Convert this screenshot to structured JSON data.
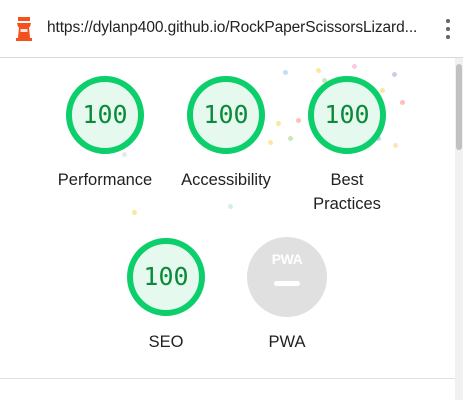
{
  "address_bar": {
    "url": "https://dylanp400.github.io/RockPaperScissorsLizard..."
  },
  "icons": {
    "app": "lighthouse-icon",
    "menu": "more-vert-icon"
  },
  "colors": {
    "pass": "#0cce6b",
    "pass_text": "#0b8a3a",
    "pass_fill": "#e6f9ee",
    "pwa_gray": "#e0e0e0",
    "lighthouse": "#f4511e"
  },
  "scores": [
    {
      "category": "Performance",
      "value": "100"
    },
    {
      "category": "Accessibility",
      "value": "100"
    },
    {
      "category": "Best Practices",
      "value": "100"
    },
    {
      "category": "SEO",
      "value": "100"
    }
  ],
  "pwa": {
    "badge": "PWA",
    "label": "PWA"
  }
}
